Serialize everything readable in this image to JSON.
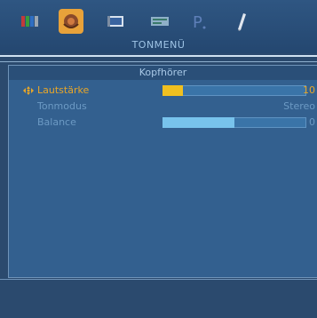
{
  "menu": {
    "title": "TONMENÜ",
    "icons": [
      {
        "name": "picture-menu-icon",
        "selected": false
      },
      {
        "name": "sound-menu-icon",
        "selected": true
      },
      {
        "name": "setup-menu-icon",
        "selected": false
      },
      {
        "name": "features-menu-icon",
        "selected": false
      },
      {
        "name": "source-menu-icon",
        "selected": false
      },
      {
        "name": "install-menu-icon",
        "selected": false
      }
    ]
  },
  "panel": {
    "header": "Kopfhörer",
    "rows": [
      {
        "label": "Lautstärke",
        "value": "10",
        "level": 0.14,
        "state": "active"
      },
      {
        "label": "Tonmodus",
        "value": "Stereo",
        "state": "inactive"
      },
      {
        "label": "Balance",
        "value": "0",
        "level": 0.5,
        "state": "inactive"
      }
    ]
  },
  "colors": {
    "accent": "#e8a628",
    "background": "#2b4a6e",
    "panel": "#33608f",
    "inactive_text": "#6c9ac4",
    "bar_fill_volume": "#f0c020",
    "bar_fill_balance": "#78c3ec"
  }
}
